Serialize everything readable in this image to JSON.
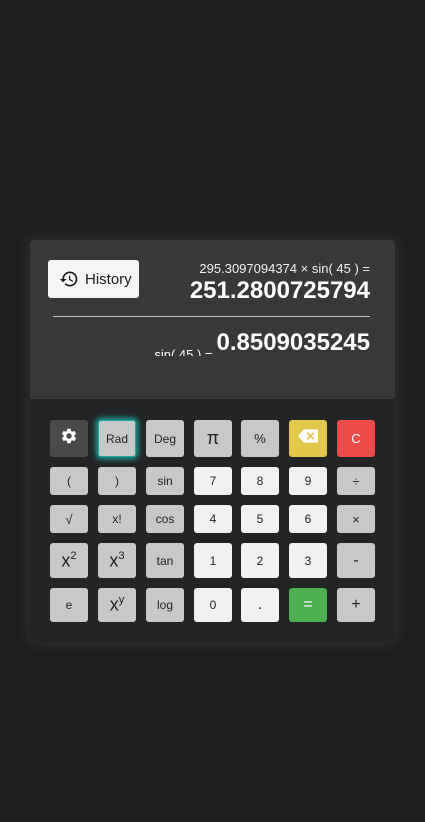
{
  "display": {
    "history_label": "History",
    "expression": "295.3097094374 × sin( 45 ) =",
    "result": "251.2800725794",
    "preview_expression": "sin( 45 ) =",
    "preview_value": "0.8509035245"
  },
  "keys": {
    "settings": "settings-gear",
    "rad": "Rad",
    "deg": "Deg",
    "pi": "π",
    "percent": "%",
    "backspace": "backspace",
    "clear": "C",
    "lparen": "(",
    "rparen": ")",
    "sin": "sin",
    "seven": "7",
    "eight": "8",
    "nine": "9",
    "divide": "÷",
    "sqrt": "√",
    "factorial": "x!",
    "cos": "cos",
    "four": "4",
    "five": "5",
    "six": "6",
    "multiply": "×",
    "square_base": "x",
    "square_exp": "2",
    "cube_base": "x",
    "cube_exp": "3",
    "tan": "tan",
    "one": "1",
    "two": "2",
    "three": "3",
    "minus": "-",
    "e": "e",
    "power_base": "x",
    "power_exp": "y",
    "log": "log",
    "zero": "0",
    "dot": ".",
    "equals": "=",
    "plus": "+"
  },
  "colors": {
    "background": "#1e1f20",
    "display": "#383838",
    "key_gray": "#c8c8c8",
    "key_white": "#f1f1f1",
    "backspace_yellow": "#e3c94b",
    "clear_red": "#ee4b4b",
    "equals_green": "#4caf50",
    "rad_glow": "#1aa8a0"
  }
}
